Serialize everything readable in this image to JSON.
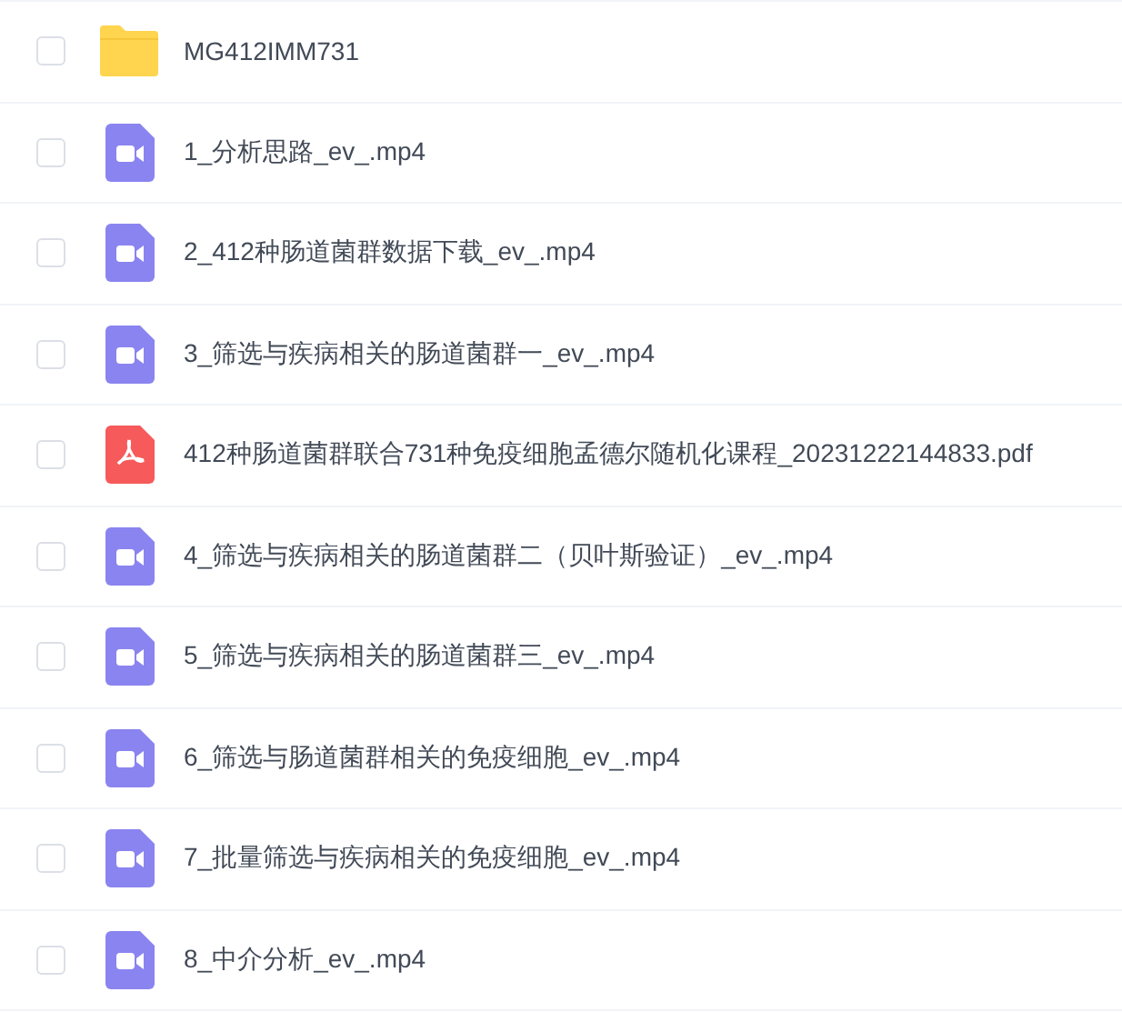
{
  "files": [
    {
      "kind": "folder",
      "name": "MG412IMM731",
      "checked": false
    },
    {
      "kind": "video",
      "name": "1_分析思路_ev_.mp4",
      "checked": false
    },
    {
      "kind": "video",
      "name": "2_412种肠道菌群数据下载_ev_.mp4",
      "checked": false
    },
    {
      "kind": "video",
      "name": "3_筛选与疾病相关的肠道菌群一_ev_.mp4",
      "checked": false
    },
    {
      "kind": "pdf",
      "name": "412种肠道菌群联合731种免疫细胞孟德尔随机化课程_20231222144833.pdf",
      "checked": false
    },
    {
      "kind": "video",
      "name": "4_筛选与疾病相关的肠道菌群二（贝叶斯验证）_ev_.mp4",
      "checked": false
    },
    {
      "kind": "video",
      "name": "5_筛选与疾病相关的肠道菌群三_ev_.mp4",
      "checked": false
    },
    {
      "kind": "video",
      "name": "6_筛选与肠道菌群相关的免疫细胞_ev_.mp4",
      "checked": false
    },
    {
      "kind": "video",
      "name": "7_批量筛选与疾病相关的免疫细胞_ev_.mp4",
      "checked": false
    },
    {
      "kind": "video",
      "name": "8_中介分析_ev_.mp4",
      "checked": false
    }
  ]
}
